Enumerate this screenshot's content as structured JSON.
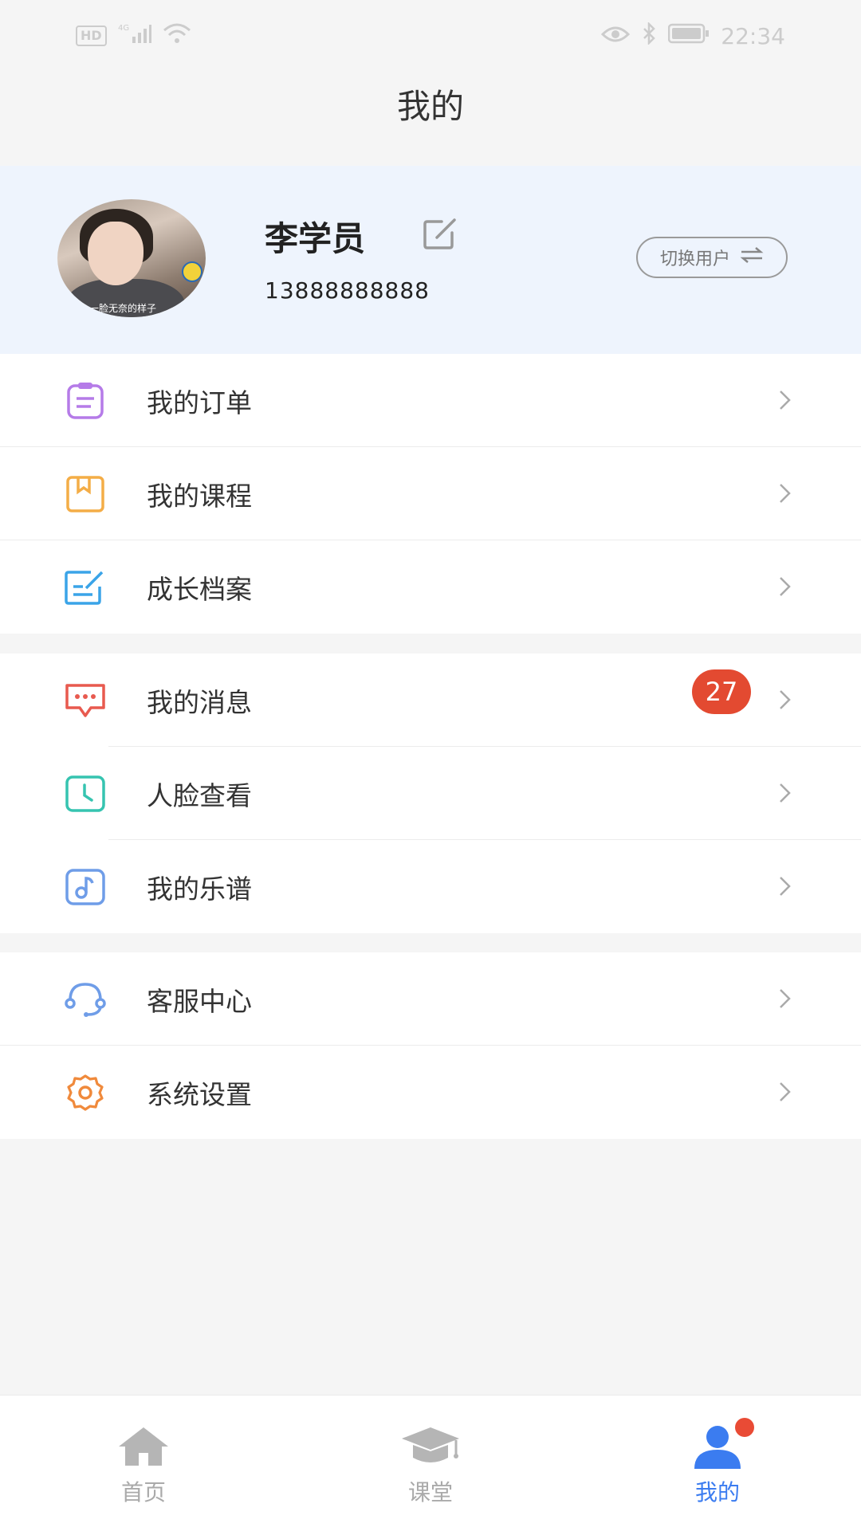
{
  "status_bar": {
    "network": "4G",
    "hd": "HD",
    "time": "22:34"
  },
  "page": {
    "title": "我的"
  },
  "profile": {
    "name": "李学员",
    "phone": "13888888888",
    "switch_label": "切换用户",
    "avatar_caption": "一脸无奈的样子"
  },
  "menu_group_1": [
    {
      "label": "我的订单",
      "icon": "clipboard-icon",
      "color": "#b57be8"
    },
    {
      "label": "我的课程",
      "icon": "bookmark-book-icon",
      "color": "#f4ad47"
    },
    {
      "label": "成长档案",
      "icon": "edit-document-icon",
      "color": "#3aa4e8"
    }
  ],
  "menu_group_2": [
    {
      "label": "我的消息",
      "icon": "chat-bubble-icon",
      "color": "#e85a4f",
      "badge": "27"
    },
    {
      "label": "人脸查看",
      "icon": "clock-icon",
      "color": "#36c4b0"
    },
    {
      "label": "我的乐谱",
      "icon": "music-note-icon",
      "color": "#6f9de8"
    }
  ],
  "menu_group_3": [
    {
      "label": "客服中心",
      "icon": "headset-icon",
      "color": "#6f9de8"
    },
    {
      "label": "系统设置",
      "icon": "gear-icon",
      "color": "#f08a3c"
    }
  ],
  "tabbar": {
    "tabs": [
      {
        "label": "首页",
        "icon": "home-icon",
        "active": false
      },
      {
        "label": "课堂",
        "icon": "graduation-cap-icon",
        "active": false
      },
      {
        "label": "我的",
        "icon": "user-group-icon",
        "active": true
      }
    ],
    "active_color": "#3b7cf0"
  }
}
